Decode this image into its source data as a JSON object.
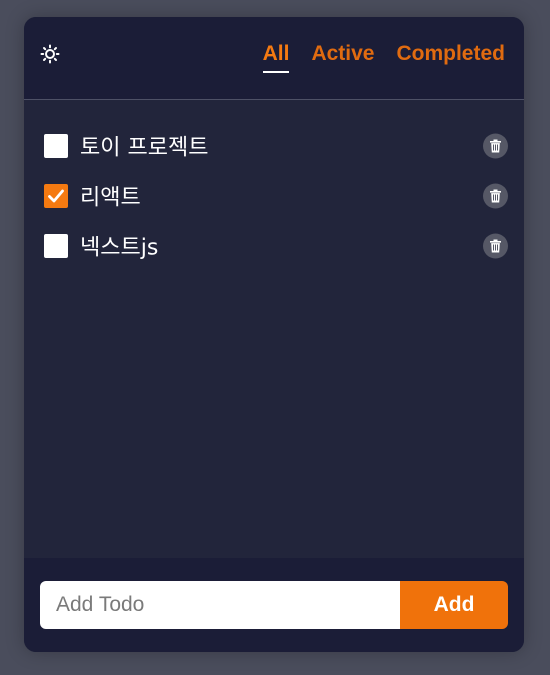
{
  "theme_toggle": {
    "icon": "sun-icon"
  },
  "filters": [
    {
      "label": "All",
      "selected": true
    },
    {
      "label": "Active",
      "selected": false
    },
    {
      "label": "Completed",
      "selected": false
    }
  ],
  "todos": [
    {
      "text": "토이 프로젝트",
      "checked": false
    },
    {
      "text": "리액트",
      "checked": true
    },
    {
      "text": "넥스트js",
      "checked": false
    }
  ],
  "add_form": {
    "placeholder": "Add Todo",
    "value": "",
    "button_label": "Add"
  },
  "colors": {
    "accent": "#f57a11",
    "header_bg": "#1b1d37",
    "body_bg": "#22253b"
  }
}
